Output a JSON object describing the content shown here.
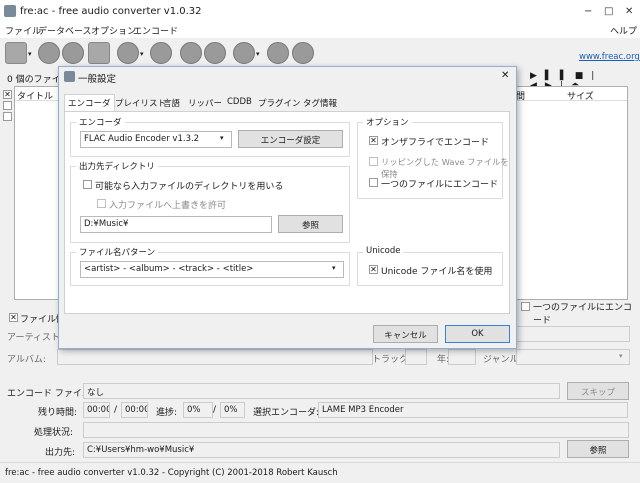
{
  "window": {
    "title": "fre:ac - free audio converter v1.0.32",
    "min": "−",
    "max": "□",
    "close": "✕"
  },
  "menu": {
    "items": [
      "ファイル",
      "データベース",
      "オプション",
      "エンコード"
    ],
    "help": "ヘルプ"
  },
  "toolbar": {
    "link": "www.freac.org",
    "icons": [
      "add-files",
      "cd",
      "playlist",
      "document",
      "search",
      "gear",
      "settings",
      "encode",
      "pause",
      "stop"
    ]
  },
  "main": {
    "file_count": "0 個のファイル",
    "columns": {
      "title": "タイトル",
      "time": "間",
      "size": "サイズ"
    },
    "player": [
      "▶",
      "▌▌",
      "■",
      "|◀",
      "▶|",
      "⏏"
    ],
    "file_info_label": "ファイル情",
    "one_file_label": "一つのファイルにエンコード",
    "artist_label": "アーティスト:",
    "album_label": "アルバム:",
    "track_label": "トラック:",
    "year_label": "年:",
    "genre_label": "ジャンル:",
    "encode_file_label": "エンコード ファイル:",
    "encode_file_value": "なし",
    "skip_button": "スキップ",
    "remaining_label": "残り時間:",
    "time_a": "00:00",
    "slash1": "/",
    "time_b": "00:00",
    "progress_label": "進捗:",
    "pct_a": "0%",
    "slash2": "/",
    "pct_b": "0%",
    "selected_encoder_label": "選択エンコーダ:",
    "selected_encoder": "LAME MP3 Encoder",
    "status_label": "処理状況:",
    "output_label": "出力先:",
    "output_value": "C:¥Users¥hm-wo¥Music¥",
    "browse_button": "参照"
  },
  "statusbar": "fre:ac - free audio converter v1.0.32 - Copyright (C) 2001-2018 Robert Kausch",
  "dialog": {
    "title": "一般設定",
    "close": "✕",
    "tabs": [
      "エンコーダ",
      "プレイリスト",
      "言語",
      "リッパー",
      "CDDB",
      "プラグイン",
      "タグ情報"
    ],
    "encoder_group": "エンコーダ",
    "encoder_value": "FLAC Audio Encoder v1.3.2",
    "encoder_settings": "エンコーダ設定",
    "output_dir_group": "出力先ディレクトリ",
    "use_input_dir": "可能なら入力ファイルのディレクトリを用いる",
    "allow_overwrite": "入力ファイルへ上書きを許可",
    "dir_value": "D:¥Music¥",
    "dir_browse": "参照",
    "pattern_group": "ファイル名パターン",
    "pattern_value": "<artist> - <album> - <track> - <title>",
    "options_group": "オプション",
    "on_the_fly": "オンザフライでエンコード",
    "keep_wave": "リッピングした Wave ファイルを保持",
    "single_file": "一つのファイルにエンコード",
    "unicode_group": "Unicode",
    "unicode_names": "Unicode ファイル名を使用",
    "cancel": "キャンセル",
    "ok": "OK",
    "check_mark": "✕",
    "dropdown_arrow": "▾"
  }
}
